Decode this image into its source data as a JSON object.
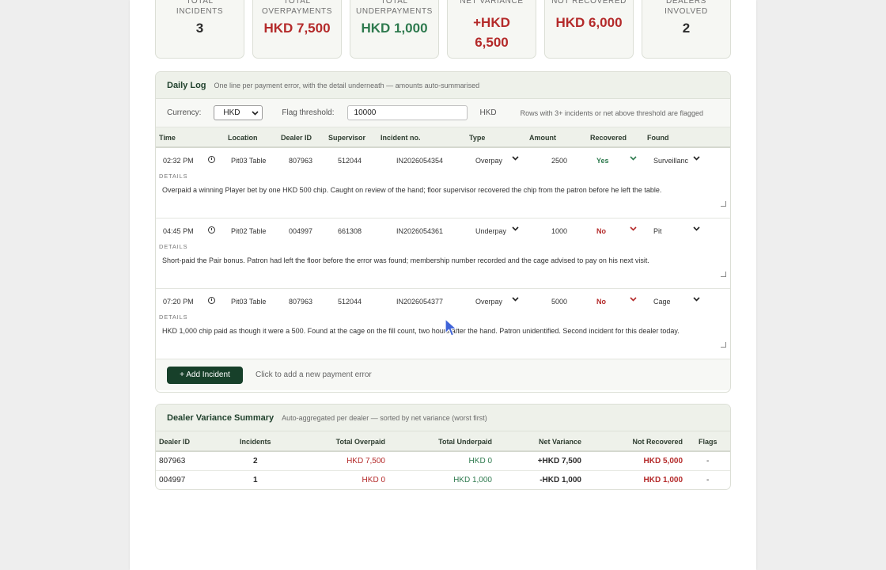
{
  "summary_cards": [
    {
      "label_line1": "TOTAL",
      "label_line2": "INCIDENTS",
      "value_line1": "3",
      "value_line2": "",
      "tone": "neutral"
    },
    {
      "label_line1": "TOTAL",
      "label_line2": "OVERPAYMENTS",
      "value_line1": "HKD 7,500",
      "value_line2": "",
      "tone": "over"
    },
    {
      "label_line1": "TOTAL",
      "label_line2": "UNDERPAYMENTS",
      "value_line1": "HKD 1,000",
      "value_line2": "",
      "tone": "under"
    },
    {
      "label_line1": "NET VARIANCE",
      "label_line2": "",
      "value_line1": "+HKD",
      "value_line2": "6,500",
      "tone": "over"
    },
    {
      "label_line1": "NOT RECOVERED",
      "label_line2": "",
      "value_line1": "HKD 6,000",
      "value_line2": "",
      "tone": "over"
    },
    {
      "label_line1": "DEALERS",
      "label_line2": "INVOLVED",
      "value_line1": "2",
      "value_line2": "",
      "tone": "neutral"
    }
  ],
  "daily_log": {
    "title": "Daily Log",
    "subtitle": "One line per payment error, with the detail underneath — amounts auto-summarised",
    "currency_label": "Currency:",
    "currency_value": "HKD",
    "threshold_label": "Flag threshold:",
    "threshold_value": "10000",
    "threshold_unit": "HKD",
    "flag_note": "Rows with 3+ incidents or net above threshold are flagged",
    "columns": {
      "time": "Time",
      "location": "Location",
      "dealer": "Dealer ID",
      "supervisor": "Supervisor",
      "incident": "Incident no.",
      "type": "Type",
      "amount": "Amount",
      "recovered": "Recovered",
      "found": "Found"
    },
    "details_label": "DETAILS",
    "incidents": [
      {
        "hh": "02",
        "mm": "32",
        "ampm": "PM",
        "location": "Pit03 Table",
        "dealer": "807963",
        "supervisor": "512044",
        "incident": "IN2026054354",
        "type": "Overpay",
        "amount": "2500",
        "recovered": "Yes",
        "found": "Surveillanc",
        "details": "Overpaid a winning Player bet by one HKD 500 chip. Caught on review of the hand; floor supervisor recovered the chip from the patron before he left the table."
      },
      {
        "hh": "04",
        "mm": "45",
        "ampm": "PM",
        "location": "Pit02 Table",
        "dealer": "004997",
        "supervisor": "661308",
        "incident": "IN2026054361",
        "type": "Underpay",
        "amount": "1000",
        "recovered": "No",
        "found": "Pit",
        "details": "Short-paid the Pair bonus. Patron had left the floor before the error was found; membership number recorded and the cage advised to pay on his next visit."
      },
      {
        "hh": "07",
        "mm": "20",
        "ampm": "PM",
        "location": "Pit03 Table",
        "dealer": "807963",
        "supervisor": "512044",
        "incident": "IN2026054377",
        "type": "Overpay",
        "amount": "5000",
        "recovered": "No",
        "found": "Cage",
        "details": "HKD 1,000 chip paid as though it were a 500. Found at the cage on the fill count, two hours after the hand. Patron unidentified. Second incident for this dealer today."
      }
    ],
    "add_button": "+ Add Incident",
    "add_hint": "Click to add a new payment error"
  },
  "dealer_summary": {
    "title": "Dealer Variance Summary",
    "subtitle": "Auto-aggregated per dealer — sorted by net variance (worst first)",
    "columns": {
      "dealer": "Dealer ID",
      "incidents": "Incidents",
      "over": "Total Overpaid",
      "under": "Total Underpaid",
      "net": "Net Variance",
      "notrec": "Not Recovered",
      "flags": "Flags"
    },
    "rows": [
      {
        "dealer": "807963",
        "incidents": "2",
        "over": "HKD 7,500",
        "under": "HKD 0",
        "net": "+HKD 7,500",
        "notrec": "HKD 5,000",
        "flags": "-"
      },
      {
        "dealer": "004997",
        "incidents": "1",
        "over": "HKD 0",
        "under": "HKD 1,000",
        "net": "-HKD 1,000",
        "notrec": "HKD 1,000",
        "flags": "-"
      }
    ]
  },
  "colors": {
    "over": "#b42a2a",
    "under": "#2e7a4e",
    "accent": "#17402a"
  }
}
